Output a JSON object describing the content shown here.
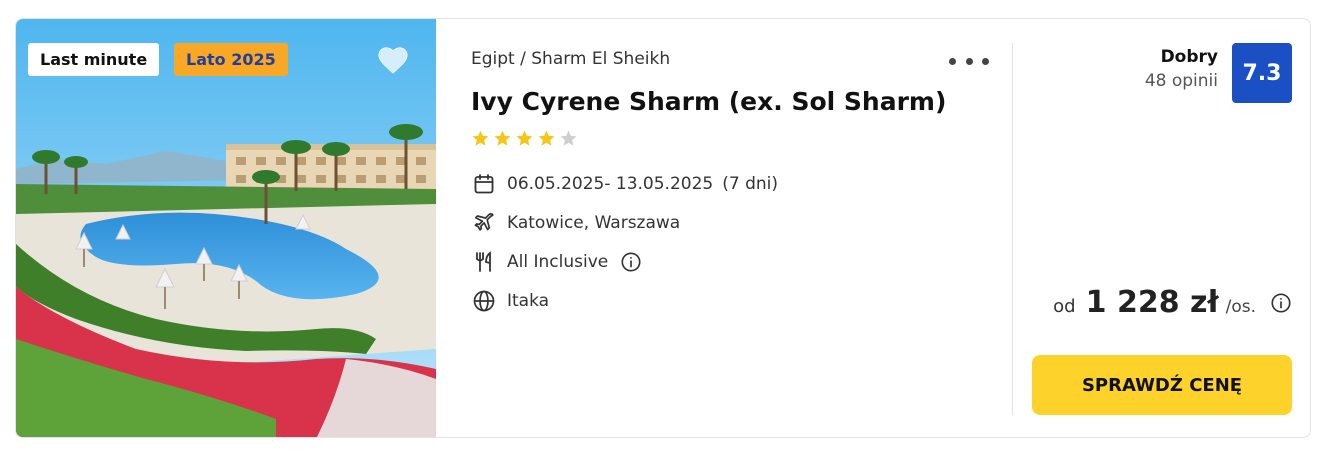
{
  "photo": {
    "badges": {
      "last_minute": "Last minute",
      "season": "Lato 2025"
    },
    "favorite_icon": "heart-icon"
  },
  "offer": {
    "location": "Egipt / Sharm El Sheikh",
    "more_icon": "more-dots-icon",
    "hotel_name": "Ivy Cyrene Sharm (ex. Sol Sharm)",
    "stars": {
      "filled": 4,
      "total": 5
    },
    "dates": "06.05.2025- 13.05.2025",
    "duration": "(7 dni)",
    "departure": "Katowice, Warszawa",
    "board": "All Inclusive",
    "operator": "Itaka",
    "icons": {
      "dates": "calendar-icon",
      "departure": "plane-icon",
      "board": "cutlery-icon",
      "board_info": "info-icon",
      "operator": "globe-icon"
    }
  },
  "rating": {
    "label": "Dobry",
    "count": "48 opinii",
    "score": "7.3"
  },
  "price": {
    "from": "od",
    "value": "1 228 zł",
    "unit": "/os.",
    "info_icon": "info-icon"
  },
  "cta": {
    "label": "SPRAWDŹ CENĘ"
  },
  "colors": {
    "rating_box": "#1b4fc4",
    "cta": "#fdd22a",
    "season_badge": "#f9a825",
    "star": "#f5c518",
    "star_empty": "#cfcfcf"
  }
}
